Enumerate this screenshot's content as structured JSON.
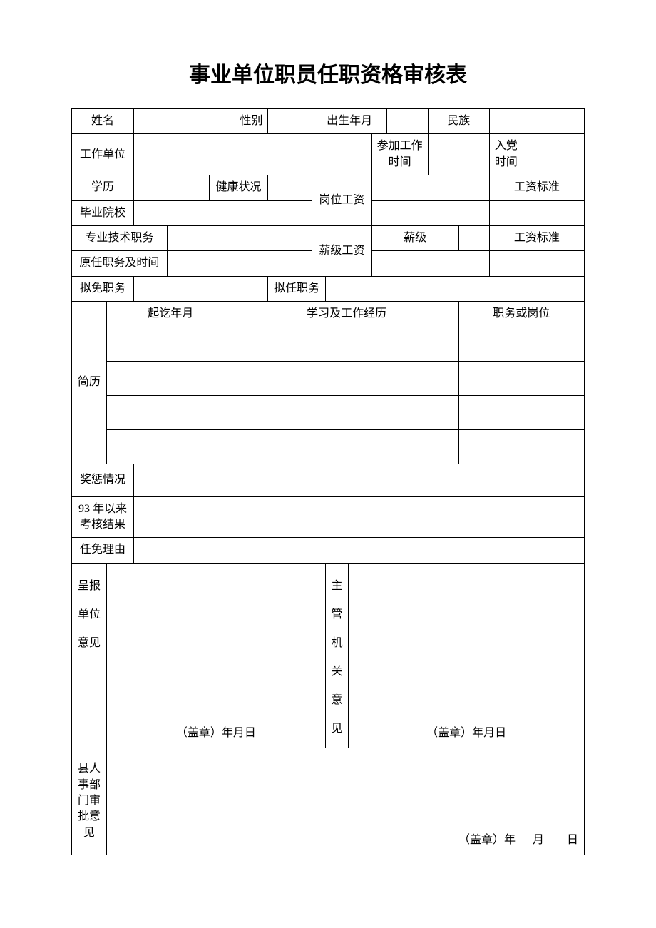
{
  "title": "事业单位职员任职资格审核表",
  "row1": {
    "name_label": "姓名",
    "name": "",
    "gender_label": "性别",
    "gender": "",
    "birth_label": "出生年月",
    "birth": "",
    "ethnic_label": "民族",
    "ethnic": ""
  },
  "row2": {
    "work_unit_label": "工作单位",
    "work_unit": "",
    "work_start_label": "参加工作时间",
    "work_start": "",
    "party_date_label": "入党时间",
    "party_date": ""
  },
  "row3": {
    "education_label": "学历",
    "education": "",
    "health_label": "健康状况",
    "health": "",
    "post_salary_label": "岗位工资",
    "post_level": "",
    "salary_standard_label": "工资标准"
  },
  "row4": {
    "school_label": "毕业院校",
    "school": "",
    "salary_standard": ""
  },
  "row5": {
    "tech_title_label": "专业技术职务",
    "tech_title": "",
    "grade_salary_label": "薪级工资",
    "grade_label": "薪级",
    "grade": "",
    "salary_standard_label": "工资标准"
  },
  "row6": {
    "former_post_label": "原任职务及时间",
    "former_post": "",
    "salary_standard": ""
  },
  "row7": {
    "dismiss_label": "拟免职务",
    "dismiss": "",
    "appoint_label": "拟任职务",
    "appoint": ""
  },
  "resume": {
    "label": "简历",
    "col1": "起讫年月",
    "col2": "学习及工作经历",
    "col3": "职务或岗位"
  },
  "rewards": {
    "label": "奖惩情况",
    "value": ""
  },
  "assessment": {
    "label": "93 年以来考核结果",
    "value": ""
  },
  "reason": {
    "label": "任免理由",
    "value": ""
  },
  "approval": {
    "submit_label": "呈报单位意见",
    "supervisor_label": "主管机关意见",
    "stamp_text": "（盖章）年月日"
  },
  "county": {
    "label": "县人事部门审批意见",
    "stamp_text": "（盖章）年",
    "month": "月",
    "day": "日"
  }
}
